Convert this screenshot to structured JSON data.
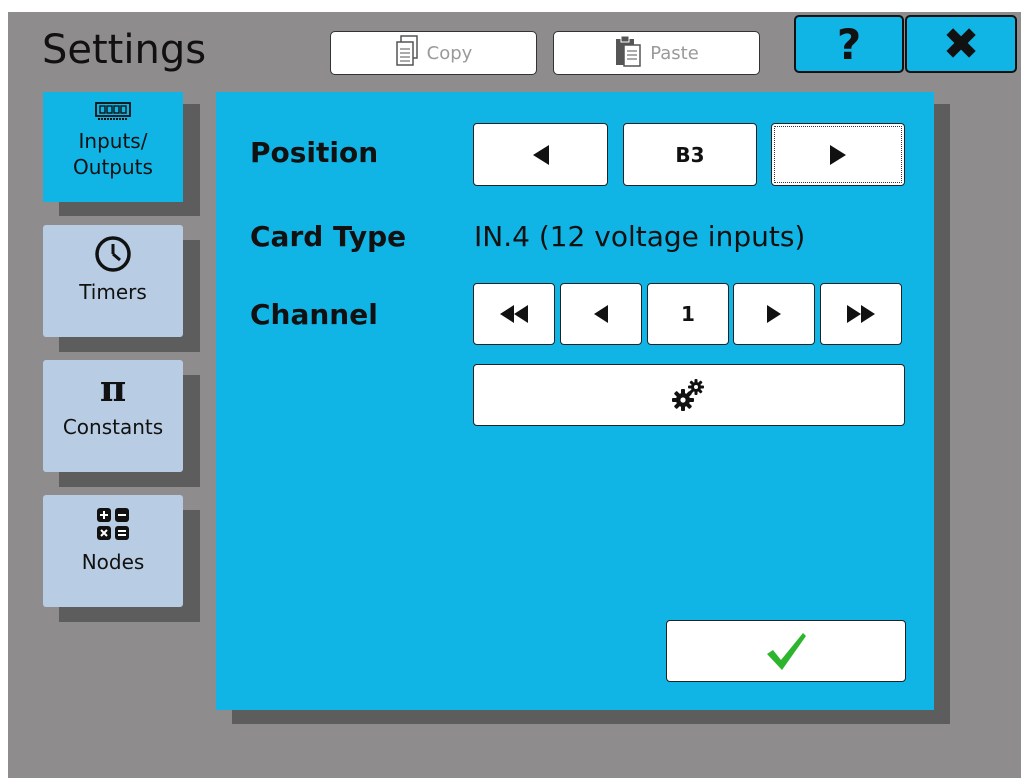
{
  "header": {
    "title": "Settings",
    "copy_label": "Copy",
    "paste_label": "Paste",
    "help_label": "?",
    "close_label": "✖"
  },
  "sidebar": {
    "items": [
      {
        "label_line1": "Inputs/",
        "label_line2": "Outputs",
        "icon": "io-card-icon",
        "selected": true
      },
      {
        "label": "Timers",
        "icon": "clock-icon"
      },
      {
        "label": "Constants",
        "icon": "pi-icon",
        "glyph": "π"
      },
      {
        "label": "Nodes",
        "icon": "math-operators-icon"
      }
    ]
  },
  "main": {
    "position_label": "Position",
    "position_value": "B3",
    "card_type_label": "Card Type",
    "card_type_value": "IN.4 (12 voltage inputs)",
    "channel_label": "Channel",
    "channel_value": "1"
  },
  "colors": {
    "accent": "#10b5e6",
    "background": "#8e8c8d",
    "tab_inactive": "#b8cde4",
    "ok_check": "#2db52d"
  }
}
